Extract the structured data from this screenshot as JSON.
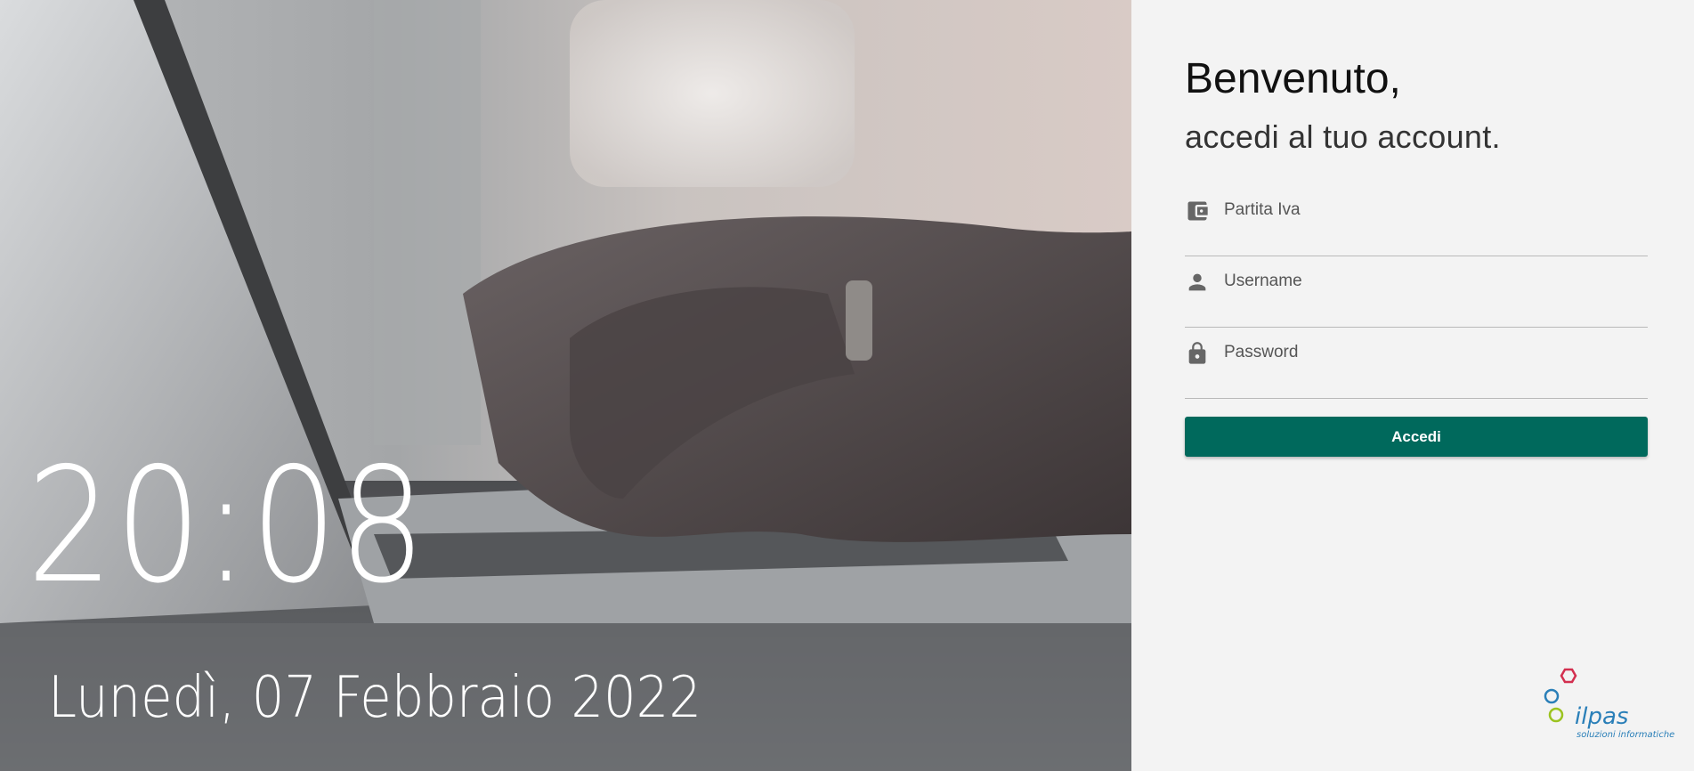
{
  "hero": {
    "time": "20:08",
    "date": "Lunedì, 07 Febbraio 2022"
  },
  "login": {
    "title": "Benvenuto,",
    "subtitle": "accedi al tuo account.",
    "fields": [
      {
        "placeholder": "Partita Iva",
        "icon": "wallet-icon"
      },
      {
        "placeholder": "Username",
        "icon": "person-icon"
      },
      {
        "placeholder": "Password",
        "icon": "lock-icon"
      }
    ],
    "submit_label": "Accedi"
  },
  "brand": {
    "name": "ilpas",
    "tagline": "soluzioni informatiche",
    "colors": {
      "red": "#d32f4f",
      "blue": "#2a7fb8",
      "green": "#9bc31f"
    }
  },
  "colors": {
    "accent": "#00695c",
    "panel_bg": "#f3f3f3"
  }
}
